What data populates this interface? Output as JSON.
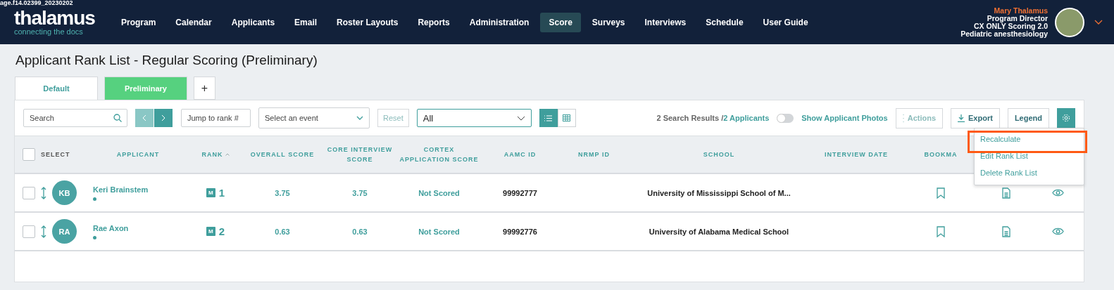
{
  "overlay_label": "age.f14.02399_20230202",
  "logo": {
    "name": "thalamus",
    "tagline": "connecting the docs"
  },
  "nav": [
    {
      "label": "Program",
      "selected": false
    },
    {
      "label": "Calendar",
      "selected": false
    },
    {
      "label": "Applicants",
      "selected": false
    },
    {
      "label": "Email",
      "selected": false
    },
    {
      "label": "Roster Layouts",
      "selected": false
    },
    {
      "label": "Reports",
      "selected": false
    },
    {
      "label": "Administration",
      "selected": false
    },
    {
      "label": "Score",
      "selected": true
    },
    {
      "label": "Surveys",
      "selected": false
    },
    {
      "label": "Interviews",
      "selected": false
    },
    {
      "label": "Schedule",
      "selected": false
    },
    {
      "label": "User Guide",
      "selected": false
    }
  ],
  "user": {
    "name": "Mary Thalamus",
    "role": "Program Director",
    "program": "CX ONLY Scoring 2.0",
    "specialty": "Pediatric anesthesiology"
  },
  "page_title": "Applicant Rank List - Regular Scoring (Preliminary)",
  "tabs": [
    {
      "label": "Default",
      "selected": false
    },
    {
      "label": "Preliminary",
      "selected": true
    }
  ],
  "add_tab": "+",
  "toolbar": {
    "search_placeholder": "Search",
    "jump_placeholder": "Jump to rank #",
    "event_placeholder": "Select an event",
    "reset": "Reset",
    "filter_value": "All",
    "views": [
      {
        "kind": "list",
        "selected": true
      },
      {
        "kind": "grid",
        "selected": false
      }
    ],
    "results": "2 Search Results / ",
    "results_count": "2 Applicants",
    "photos_toggle": {
      "label": "Show Applicant Photos",
      "on": false
    },
    "actions": "Actions",
    "export": "Export",
    "legend": "Legend"
  },
  "settings_menu": [
    {
      "label": "Recalculate",
      "highlighted": true
    },
    {
      "label": "Edit Rank List",
      "highlighted": false
    },
    {
      "label": "Delete Rank List",
      "highlighted": false
    }
  ],
  "table": {
    "select_label": "SELECT",
    "select_all_checked": false,
    "columns": [
      "APPLICANT",
      "RANK",
      "OVERALL SCORE",
      "CORE INTERVIEW SCORE",
      "CORTEX APPLICATION SCORE",
      "AAMC ID",
      "NRMP ID",
      "SCHOOL",
      "INTERVIEW DATE",
      "BOOKMA"
    ],
    "rows": [
      {
        "checked": false,
        "initials": "KB",
        "name": "Keri Brainstem",
        "badge": "M",
        "rank": "1",
        "overall": "3.75",
        "core": "3.75",
        "cortex": "Not Scored",
        "aamc": "99992777",
        "school": "University of Mississippi School of M..."
      },
      {
        "checked": false,
        "initials": "RA",
        "name": "Rae Axon",
        "badge": "M",
        "rank": "2",
        "overall": "0.63",
        "core": "0.63",
        "cortex": "Not Scored",
        "aamc": "99992776",
        "school": "University of Alabama Medical School"
      }
    ]
  }
}
